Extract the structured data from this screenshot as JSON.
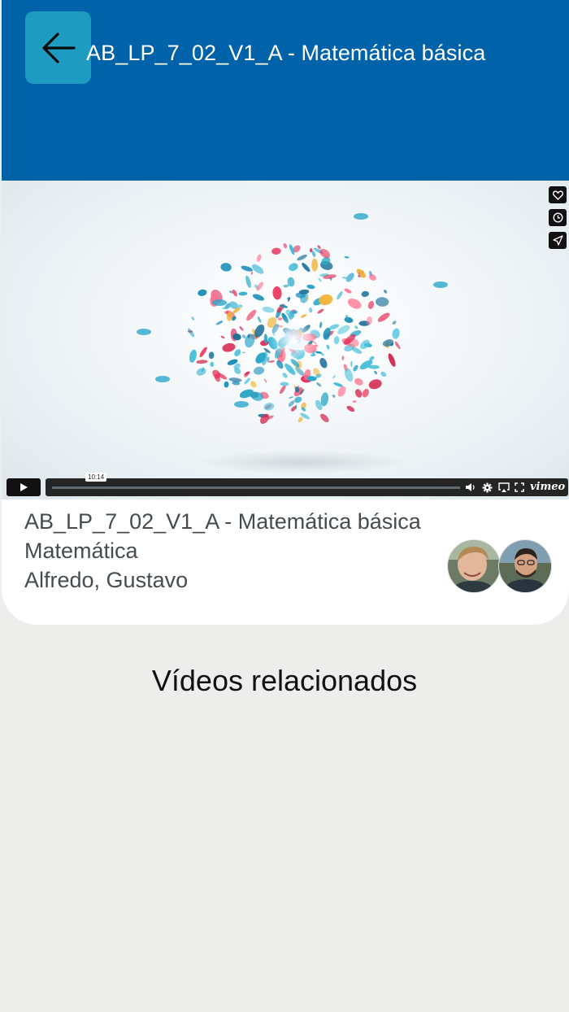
{
  "header": {
    "title": "AB_LP_7_02_V1_A - Matemática básica",
    "back_icon": "arrow-left-icon"
  },
  "player": {
    "time_tooltip": "10:14",
    "brand": "vimeo",
    "side_icons": [
      "heart-icon",
      "clock-icon",
      "send-icon"
    ],
    "control_icons": [
      "play-icon",
      "volume-icon",
      "gear-icon",
      "airplay-icon",
      "fullscreen-icon"
    ]
  },
  "info": {
    "title": "AB_LP_7_02_V1_A - Matemática básica",
    "subject": "Matemática",
    "authors": "Alfredo, Gustavo"
  },
  "related": {
    "heading": "Vídeos relacionados"
  },
  "colors": {
    "header_bg": "#0062a8",
    "back_button_bg": "#1d9bc1",
    "page_bg": "#ededeb"
  }
}
